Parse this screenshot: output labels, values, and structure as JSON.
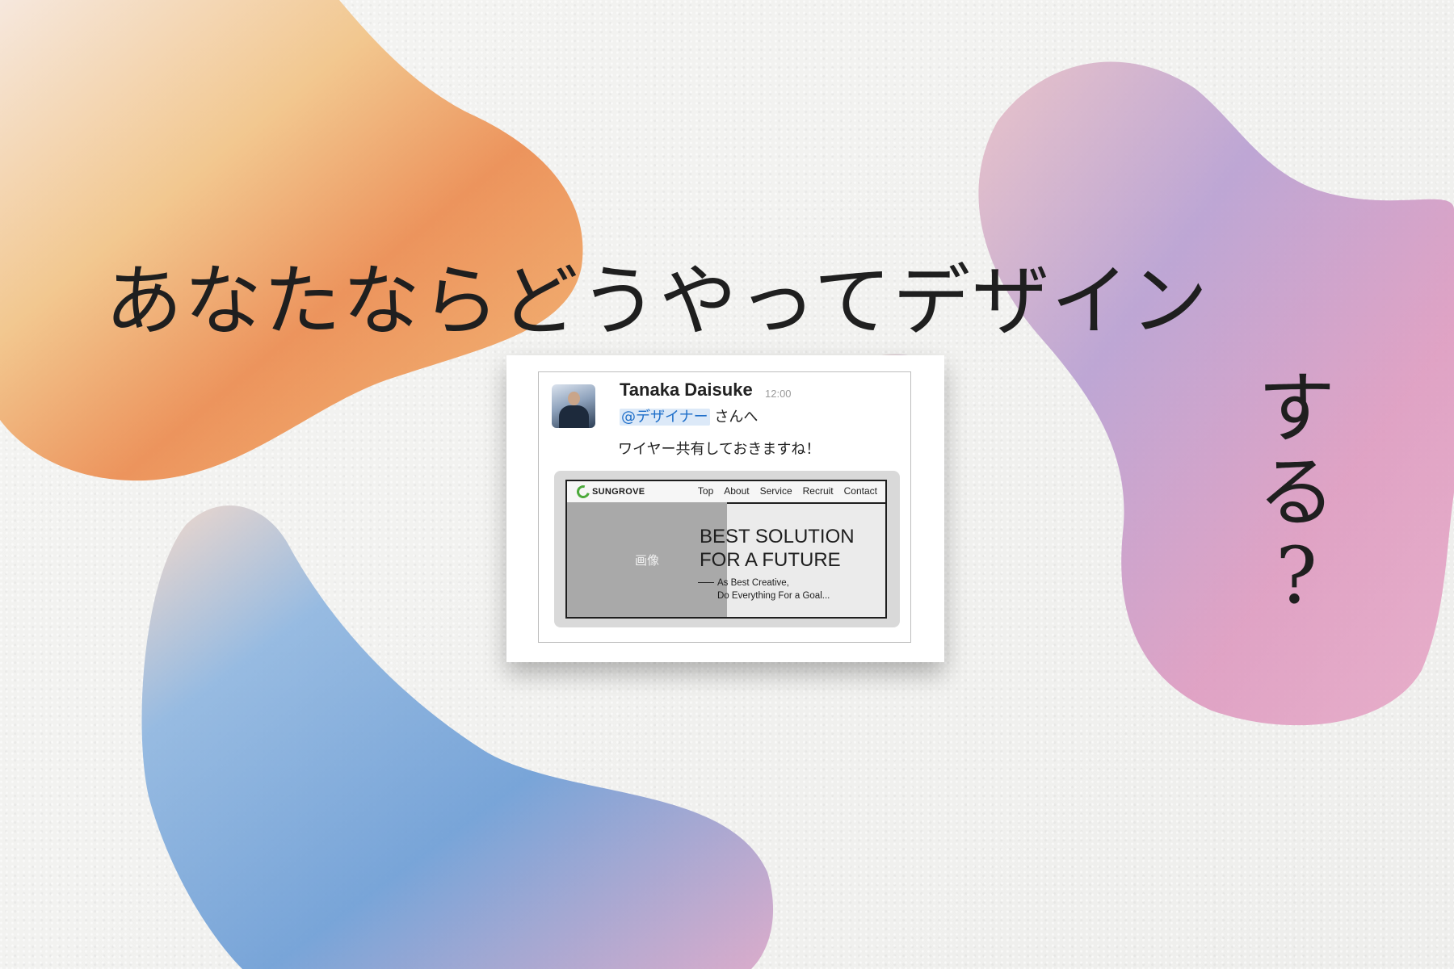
{
  "headline": {
    "horizontal": "あなたならどうやってデザイン",
    "vertical": [
      "す",
      "る",
      "?"
    ]
  },
  "chat": {
    "sender": "Tanaka Daisuke",
    "time": "12:00",
    "mention": "@デザイナー",
    "mention_suffix": " さんへ",
    "message": "ワイヤー共有しておきますね！"
  },
  "wireframe": {
    "logo": "SUNGROVE",
    "nav": [
      "Top",
      "About",
      "Service",
      "Recruit",
      "Contact"
    ],
    "image_placeholder": "画像",
    "hero_title": [
      "BEST SOLUTION",
      "FOR A FUTURE"
    ],
    "hero_sub": [
      "As Best Creative,",
      "Do Everything For a Goal..."
    ]
  },
  "colors": {
    "headline": "#1f1f1f",
    "mention_bg": "#dce9f8",
    "mention_text": "#1f6fc9",
    "wire_image": "#a9a9a9",
    "logo_green": "#4caa3b"
  }
}
